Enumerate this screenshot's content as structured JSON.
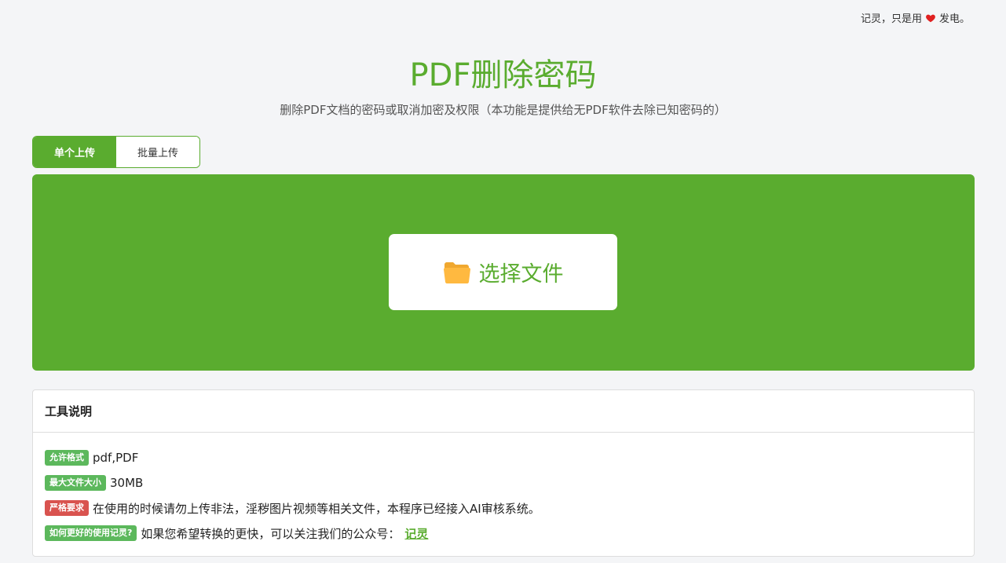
{
  "header": {
    "note_prefix": "记灵，只是用",
    "note_suffix": "发电。",
    "heart_color": "#e02020"
  },
  "page": {
    "title": "PDF删除密码",
    "subtitle": "删除PDF文档的密码或取消加密及权限（本功能是提供给无PDF软件去除已知密码的）"
  },
  "tabs": [
    {
      "label": "单个上传",
      "active": true
    },
    {
      "label": "批量上传",
      "active": false
    }
  ],
  "upload": {
    "button_label": "选择文件",
    "icon": "folder-icon"
  },
  "info": {
    "heading": "工具说明",
    "rows": [
      {
        "badge": "允许格式",
        "text": "pdf,PDF"
      },
      {
        "badge": "最大文件大小",
        "text": "30MB"
      },
      {
        "badge": "严格要求",
        "text": "在使用的时候请勿上传非法，淫秽图片视频等相关文件，本程序已经接入AI审核系统。"
      },
      {
        "badge": "如何更好的使用记灵?",
        "text": "如果您希望转换的更快，可以关注我们的公众号：",
        "link": "记灵"
      }
    ]
  },
  "colors": {
    "accent": "#5aac2f",
    "badge_green": "#5cb85c",
    "badge_red": "#d9534f"
  }
}
